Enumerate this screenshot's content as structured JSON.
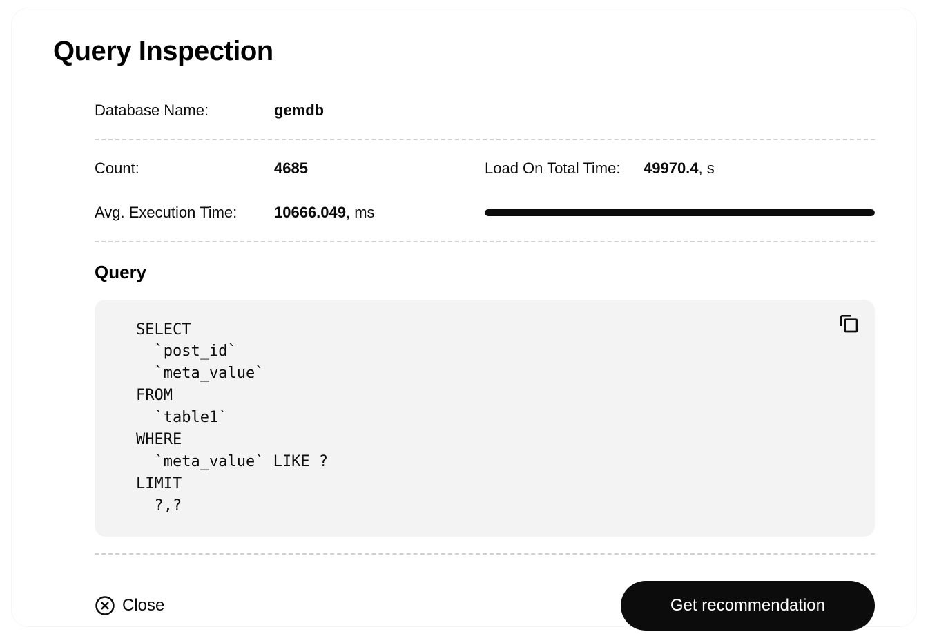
{
  "title": "Query Inspection",
  "details": {
    "database_label": "Database Name:",
    "database_value": "gemdb",
    "count_label": "Count:",
    "count_value": "4685",
    "load_label": "Load On Total Time:",
    "load_value": "49970.4",
    "load_unit": ", s",
    "avg_label": "Avg. Execution Time:",
    "avg_value": "10666.049",
    "avg_unit": ", ms",
    "progress_percent": 100
  },
  "query_section": {
    "heading": "Query",
    "sql": "SELECT\n  `post_id`\n  `meta_value`\nFROM\n  `table1`\nWHERE\n  `meta_value` LIKE ?\nLIMIT\n  ?,?"
  },
  "footer": {
    "close_label": "Close",
    "primary_label": "Get recommendation"
  }
}
